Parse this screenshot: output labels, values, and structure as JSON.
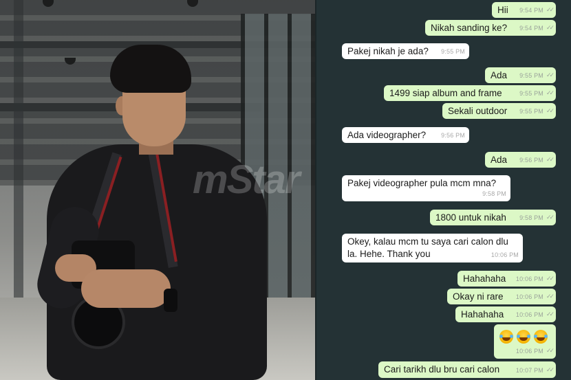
{
  "watermark": "mStar",
  "colors": {
    "chat_bg": "#243235",
    "outgoing_bubble": "#dcf8c6",
    "incoming_bubble": "#ffffff"
  },
  "messages": [
    {
      "dir": "out",
      "text": "Hii",
      "time": "9:54 PM"
    },
    {
      "dir": "out",
      "text": "Nikah sanding ke?",
      "time": "9:54 PM"
    },
    {
      "dir": "in",
      "text": "Pakej nikah je ada?",
      "time": "9:55 PM"
    },
    {
      "dir": "out",
      "text": "Ada",
      "time": "9:55 PM"
    },
    {
      "dir": "out",
      "text": "1499 siap album and frame",
      "time": "9:55 PM"
    },
    {
      "dir": "out",
      "text": "Sekali outdoor",
      "time": "9:55 PM"
    },
    {
      "dir": "in",
      "text": "Ada videographer?",
      "time": "9:56 PM"
    },
    {
      "dir": "out",
      "text": "Ada",
      "time": "9:56 PM"
    },
    {
      "dir": "in",
      "text": "Pakej videographer pula mcm mna?",
      "time": "9:58 PM"
    },
    {
      "dir": "out",
      "text": "1800 untuk nikah",
      "time": "9:58 PM"
    },
    {
      "dir": "in",
      "text": "Okey, kalau mcm tu saya cari calon dlu",
      "text2": "la. Hehe. Thank you",
      "time": "10:06 PM"
    },
    {
      "dir": "out",
      "text": "Hahahaha",
      "time": "10:06 PM"
    },
    {
      "dir": "out",
      "text": "Okay ni rare",
      "time": "10:06 PM"
    },
    {
      "dir": "out",
      "text": "Hahahaha",
      "time": "10:06 PM"
    },
    {
      "dir": "out",
      "emoji": "face-with-tears-of-joy x3",
      "time": "10:06 PM"
    },
    {
      "dir": "out",
      "text": "Cari tarikh dlu bru cari calon",
      "time": "10:07 PM"
    }
  ]
}
